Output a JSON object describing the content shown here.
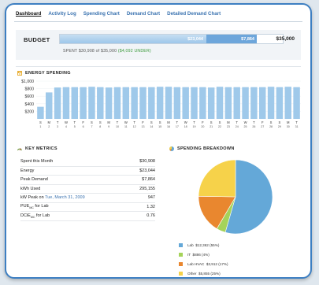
{
  "tabs": [
    {
      "label": "Dashboard",
      "active": true
    },
    {
      "label": "Activity Log",
      "active": false
    },
    {
      "label": "Spending Chart",
      "active": false
    },
    {
      "label": "Demand Chart",
      "active": false
    },
    {
      "label": "Detailed Demand Chart",
      "active": false
    }
  ],
  "budget": {
    "label": "BUDGET",
    "energy_value": "$23,044",
    "peak_value": "$7,864",
    "total": "$35,000",
    "spent_text": "SPENT $30,908 of $35,000",
    "under_text": "($4,092 UNDER)",
    "energy_fraction": 0.658,
    "peak_fraction": 0.225
  },
  "energy": {
    "title": "ENERGY SPENDING",
    "bar_color": "#9fc9ea",
    "chart_data": {
      "type": "bar",
      "yticks": [
        "$1,000",
        "$800",
        "$600",
        "$400",
        "$200"
      ],
      "ylim": [
        0,
        1000
      ],
      "categories": [
        "S",
        "M",
        "T",
        "W",
        "T",
        "F",
        "S",
        "S",
        "M",
        "T",
        "W",
        "T",
        "F",
        "S",
        "S",
        "M",
        "T",
        "W",
        "T",
        "F",
        "S",
        "S",
        "M",
        "T",
        "W",
        "T",
        "F",
        "S",
        "S",
        "M",
        "T"
      ],
      "days": [
        "1",
        "2",
        "3",
        "4",
        "5",
        "6",
        "7",
        "8",
        "9",
        "10",
        "11",
        "12",
        "13",
        "14",
        "15",
        "16",
        "17",
        "18",
        "19",
        "20",
        "21",
        "22",
        "23",
        "24",
        "25",
        "26",
        "27",
        "28",
        "29",
        "30",
        "31"
      ],
      "values": [
        320,
        700,
        830,
        840,
        840,
        840,
        850,
        840,
        830,
        840,
        840,
        840,
        840,
        840,
        850,
        850,
        840,
        840,
        840,
        840,
        830,
        850,
        840,
        840,
        840,
        840,
        840,
        850,
        840,
        850,
        840
      ]
    }
  },
  "metrics": {
    "title": "KEY METRICS",
    "rows": [
      {
        "label": "Spent this Month",
        "value": "$30,908"
      },
      {
        "label": "Energy",
        "value": "$23,044"
      },
      {
        "label": "Peak Demand",
        "value": "$7,864"
      },
      {
        "label": "kWh Used",
        "value": "295,155"
      },
      {
        "label": "kW Peak on",
        "date": "Tue, March 31, 2009",
        "value": "947"
      },
      {
        "label": "PUE",
        "sub": "MC",
        "tail": " for Lab",
        "value": "1.32"
      },
      {
        "label": "DCiE",
        "sub": "MC",
        "tail": " for Lab",
        "value": "0.76"
      }
    ]
  },
  "breakdown": {
    "title": "SPENDING BREAKDOWN",
    "chart_data": {
      "type": "pie",
      "slices": [
        {
          "label": "Lab  $12,362 (55%)",
          "value": 55,
          "color": "#64a8d8"
        },
        {
          "label": "IT  $886 (4%)",
          "value": 4,
          "color": "#a5d35a"
        },
        {
          "label": "Lab HVAC  $3,912 (17%)",
          "value": 17,
          "color": "#e9872f"
        },
        {
          "label": "Other  $5,855 (25%)",
          "value": 25,
          "color": "#f6d24a"
        }
      ]
    }
  }
}
